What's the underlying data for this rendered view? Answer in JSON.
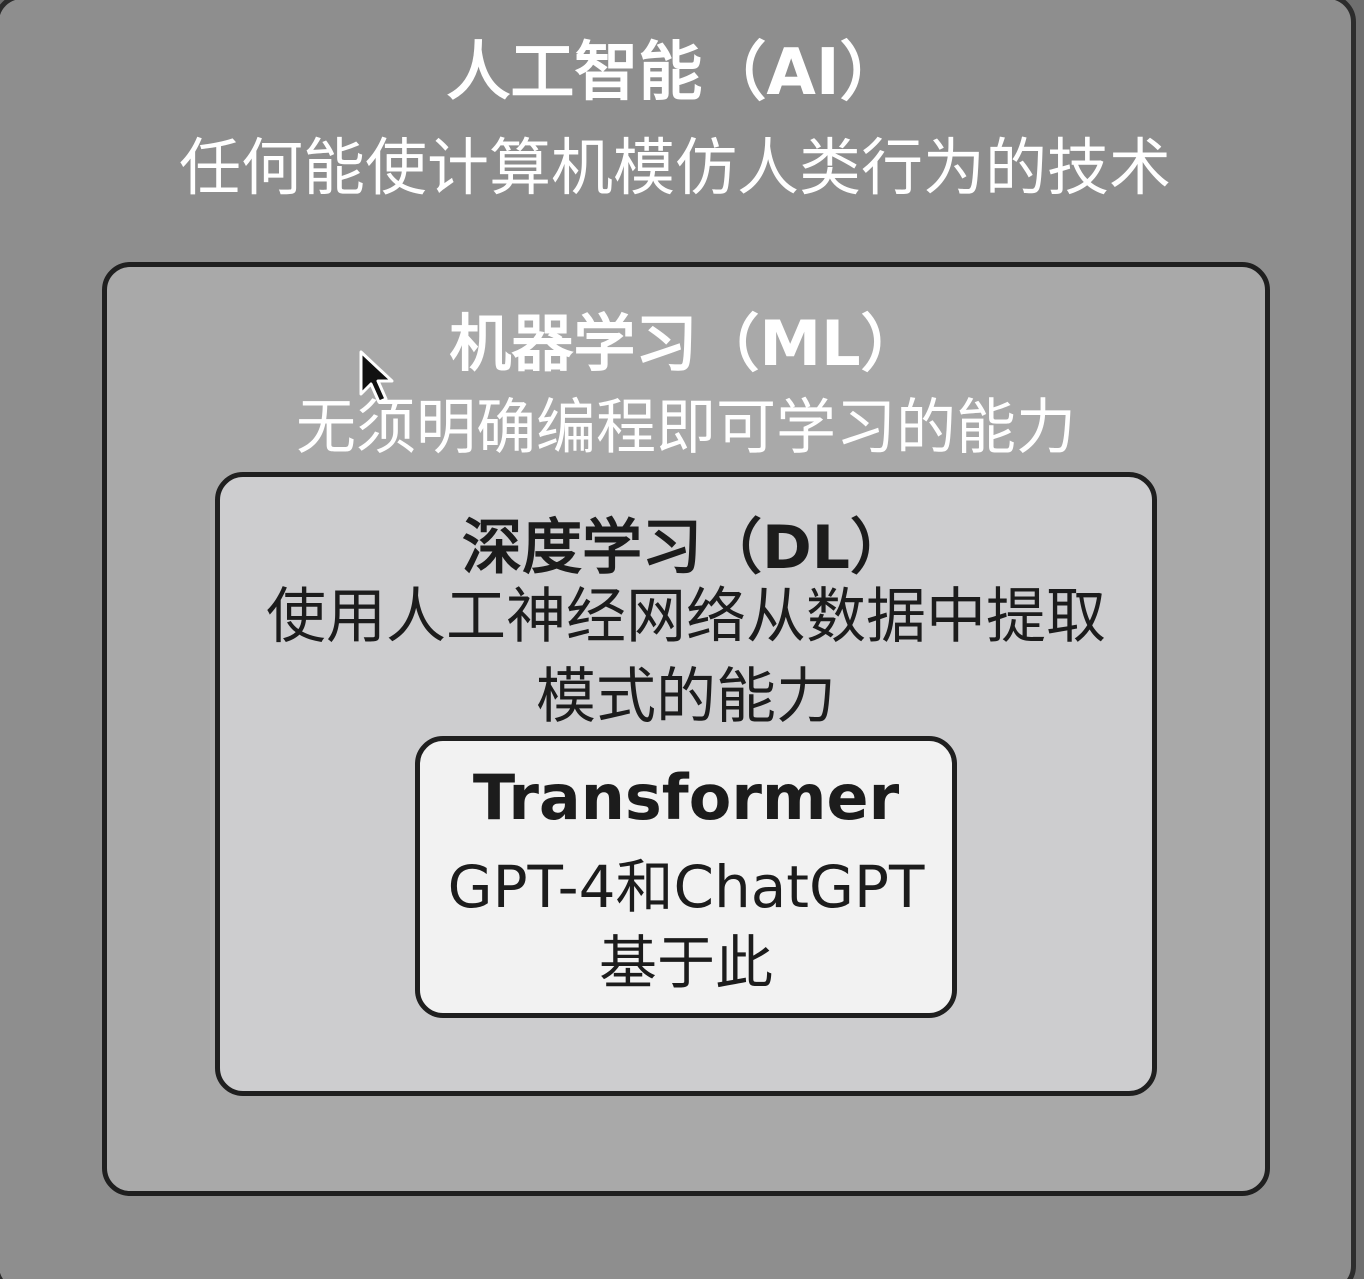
{
  "levels": {
    "ai": {
      "title": "人工智能（AI）",
      "description": "任何能使计算机模仿人类行为的技术"
    },
    "ml": {
      "title": "机器学习（ML）",
      "description": "无须明确编程即可学习的能力"
    },
    "dl": {
      "title": "深度学习（DL）",
      "description": "使用人工神经网络从数据中提取模式的能力"
    },
    "transformer": {
      "title": "Transformer",
      "description": "GPT-4和ChatGPT基于此"
    }
  },
  "colors": {
    "ai_fill": "#8e8e8e",
    "ml_fill": "#a9a9a9",
    "dl_fill": "#cdcdcf",
    "transformer_fill": "#f2f2f2",
    "border": "#1f1f1f"
  },
  "icons": {
    "cursor": "mouse-pointer-arrow"
  }
}
